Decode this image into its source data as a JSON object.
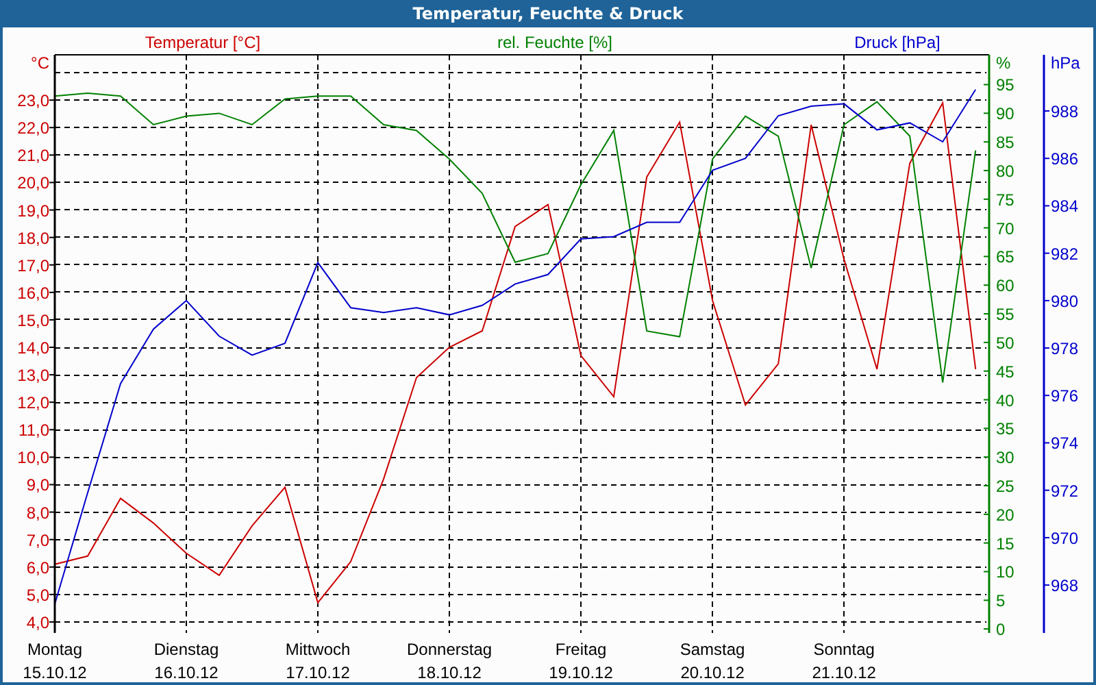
{
  "window": {
    "title": "Temperatur, Feuchte & Druck"
  },
  "chart_data": {
    "type": "line",
    "grid": true,
    "categories": [
      "Montag",
      null,
      null,
      null,
      "Dienstag",
      null,
      null,
      null,
      "Mittwoch",
      null,
      null,
      null,
      "Donnerstag",
      null,
      null,
      null,
      "Freitag",
      null,
      null,
      null,
      "Samstag",
      null,
      null,
      null,
      "Sonntag",
      null,
      null,
      null,
      null
    ],
    "ylabel": "°C",
    "ylim": [
      3.6,
      24.65
    ],
    "yticks": [
      {
        "value": 23,
        "label": "23,0"
      },
      {
        "value": 22,
        "label": "22,0"
      },
      {
        "value": 21,
        "label": "21,0"
      },
      {
        "value": 20,
        "label": "20,0"
      },
      {
        "value": 19,
        "label": "19,0"
      },
      {
        "value": 18,
        "label": "18,0"
      },
      {
        "value": 17,
        "label": "17,0"
      },
      {
        "value": 16,
        "label": "16,0"
      },
      {
        "value": 15,
        "label": "15,0"
      },
      {
        "value": 14,
        "label": "14,0"
      },
      {
        "value": 13,
        "label": "13,0"
      },
      {
        "value": 12,
        "label": "12,0"
      },
      {
        "value": 11,
        "label": "11,0"
      },
      {
        "value": 10,
        "label": "10,0"
      },
      {
        "value": 9,
        "label": "9,0"
      },
      {
        "value": 8,
        "label": "8,0"
      },
      {
        "value": 7,
        "label": "7,0"
      },
      {
        "value": 6,
        "label": "6,0"
      },
      {
        "value": 5,
        "label": "5,0"
      },
      {
        "value": 4,
        "label": "4,0"
      }
    ],
    "y2label": "%",
    "y2lim": [
      -0.7,
      100.2
    ],
    "y2ticks": [
      95,
      90,
      85,
      80,
      75,
      70,
      65,
      60,
      55,
      50,
      45,
      40,
      35,
      30,
      25,
      20,
      15,
      10,
      5,
      0
    ],
    "y3label": "hPa",
    "y3lim": [
      965.98,
      990.37
    ],
    "y3ticks": [
      988,
      986,
      984,
      982,
      980,
      978,
      976,
      974,
      972,
      970,
      968
    ],
    "series": [
      {
        "name": "Temperatur [°C]",
        "color": "#cc0000",
        "values": [
          6.1,
          6.4,
          8.5,
          7.6,
          6.5,
          5.7,
          7.5,
          8.9,
          4.7,
          6.2,
          9.2,
          12.9,
          14.0,
          14.6,
          18.4,
          19.2,
          13.7,
          12.2,
          20.2,
          22.2,
          15.7,
          11.9,
          13.4,
          22.1,
          17.2,
          13.2,
          20.7,
          22.9,
          13.2
        ]
      },
      {
        "name": "rel. Feuchte [%]",
        "color": "#008000",
        "axis": "y2",
        "values": [
          93,
          93.5,
          93,
          88,
          89.5,
          90,
          88,
          92.5,
          93,
          93,
          88,
          87,
          82,
          76,
          64,
          65.5,
          77.5,
          87,
          52,
          51,
          82,
          89.5,
          86,
          63,
          88,
          92,
          86,
          43,
          83.5
        ]
      },
      {
        "name": "Druck [hPa]",
        "color": "#0000cc",
        "axis": "y3",
        "values": [
          967.2,
          971.9,
          976.5,
          978.8,
          980,
          978.5,
          977.7,
          978.2,
          981.6,
          979.7,
          979.5,
          979.7,
          979.4,
          979.8,
          980.7,
          981.1,
          982.6,
          982.7,
          983.3,
          983.3,
          985.5,
          986,
          987.8,
          988.2,
          988.3,
          987.2,
          987.5,
          986.7,
          988.9
        ]
      }
    ]
  },
  "dates": [
    "15.10.12",
    "16.10.12",
    "17.10.12",
    "18.10.12",
    "19.10.12",
    "20.10.12",
    "21.10.12"
  ]
}
